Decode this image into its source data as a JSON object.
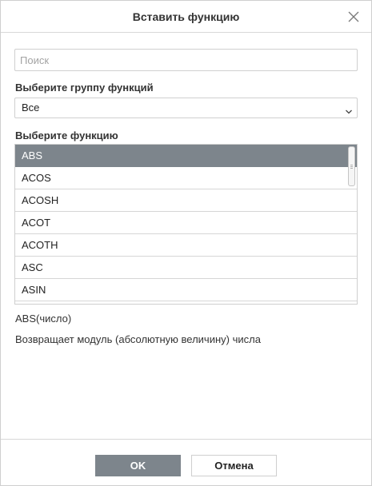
{
  "dialog": {
    "title": "Вставить функцию",
    "close_icon": "close-icon"
  },
  "search": {
    "placeholder": "Поиск",
    "value": ""
  },
  "group": {
    "label": "Выберите группу функций",
    "selected": "Все"
  },
  "functions": {
    "label": "Выберите функцию",
    "items": [
      "ABS",
      "ACOS",
      "ACOSH",
      "ACOT",
      "ACOTH",
      "ASC",
      "ASIN"
    ],
    "selected": "ABS"
  },
  "info": {
    "syntax": "ABS(число)",
    "description": "Возвращает модуль (абсолютную величину) числа"
  },
  "footer": {
    "ok_label": "OK",
    "cancel_label": "Отмена"
  },
  "colors": {
    "selected_bg": "#7d858c",
    "border": "#cfcfcf"
  }
}
